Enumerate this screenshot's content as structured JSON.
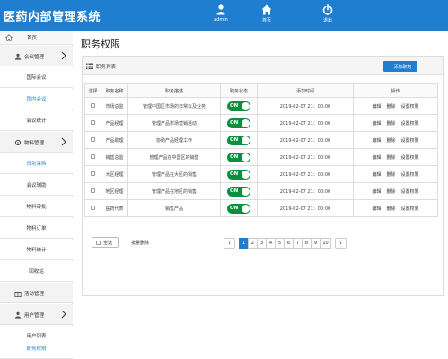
{
  "app": {
    "title": "医药内部管理系统"
  },
  "header_nav": [
    {
      "label": "admin",
      "icon": "user-icon"
    },
    {
      "label": "首页",
      "icon": "home-icon"
    },
    {
      "label": "退出",
      "icon": "power-icon"
    }
  ],
  "sidebar": {
    "home": "首页",
    "meeting_group": "会议管理",
    "meeting_items": [
      "国际会议",
      "国内会议",
      "会议统计"
    ],
    "material_group": "物料管理",
    "material_items": [
      "日常采购",
      "会议辅助",
      "物料审批",
      "物料订单",
      "物料统计",
      "回收站"
    ],
    "activity_group": "活动管理",
    "user_group": "用户管理",
    "user_items": [
      "用户列表",
      "职务权限"
    ]
  },
  "page": {
    "title": "职务权限",
    "list_title": "职务列表",
    "add_button": "添加职务"
  },
  "table": {
    "headers": [
      "选择",
      "职务名称",
      "职务描述",
      "职务状态",
      "添加时间",
      "操作"
    ],
    "rows": [
      {
        "name": "市场总监",
        "desc": "管理中国区市场的日常以及业务",
        "status": "ON",
        "time": "2019-02-07 21：00:00"
      },
      {
        "name": "产品经理",
        "desc": "管理产品市场营销活动",
        "status": "ON",
        "time": "2019-02-07 21：00:00"
      },
      {
        "name": "产品助理",
        "desc": "协助产品经理工作",
        "status": "ON",
        "time": "2019-02-07 21：00:00"
      },
      {
        "name": "销售总监",
        "desc": "管理产品在中国区的销售",
        "status": "ON",
        "time": "2019-02-07 21：00:00"
      },
      {
        "name": "大区经理",
        "desc": "管理产品在大区的销售",
        "status": "ON",
        "time": "2019-02-07 21：00:00"
      },
      {
        "name": "地区经理",
        "desc": "管理产品在地区的销售",
        "status": "ON",
        "time": "2019-02-07 21：00:00"
      },
      {
        "name": "医药代表",
        "desc": "销售产品",
        "status": "ON",
        "time": "2019-02-07 21：00:00"
      }
    ],
    "actions": [
      "编辑",
      "删除",
      "设置权限"
    ]
  },
  "footer": {
    "select_all": "全选",
    "batch_delete": "批量删除"
  },
  "pagination": {
    "prev": "‹",
    "next": "›",
    "pages": [
      "1",
      "2",
      "3",
      "4",
      "5",
      "6",
      "7",
      "8",
      "9",
      "10"
    ],
    "current": 1
  },
  "colors": {
    "primary": "#1f7ed0",
    "toggle_on": "#0c8f3e"
  }
}
